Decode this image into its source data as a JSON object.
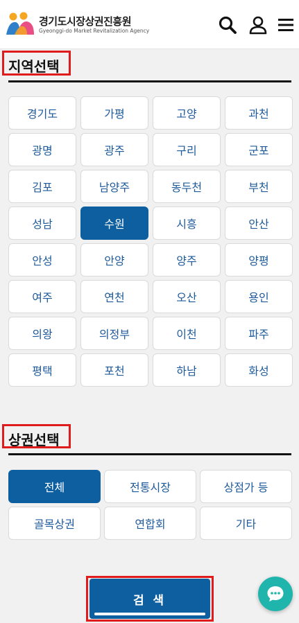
{
  "header": {
    "brand_name": "경기도시장상권진흥원",
    "brand_subtitle": "Gyeonggi-do Market Revitalization Agency"
  },
  "icons": {
    "logo": "agency-logo",
    "search": "search-icon",
    "user": "user-icon",
    "menu": "hamburger-menu-icon",
    "chat": "chat-bubble-icon"
  },
  "colors": {
    "primary": "#0d5fa0",
    "option_text": "#1e5a9b",
    "highlight_box": "#e01b1b",
    "chat_fab": "#1fb5ac"
  },
  "region": {
    "title": "지역선택",
    "selected": "수원",
    "options": [
      "경기도",
      "가평",
      "고양",
      "과천",
      "광명",
      "광주",
      "구리",
      "군포",
      "김포",
      "남양주",
      "동두천",
      "부천",
      "성남",
      "수원",
      "시흥",
      "안산",
      "안성",
      "안양",
      "양주",
      "양평",
      "여주",
      "연천",
      "오산",
      "용인",
      "의왕",
      "의정부",
      "이천",
      "파주",
      "평택",
      "포천",
      "하남",
      "화성"
    ]
  },
  "district": {
    "title": "상권선택",
    "selected": "전체",
    "options": [
      "전체",
      "전통시장",
      "상점가 등",
      "골목상권",
      "연합회",
      "기타"
    ]
  },
  "search_button": {
    "label": "검 색"
  }
}
